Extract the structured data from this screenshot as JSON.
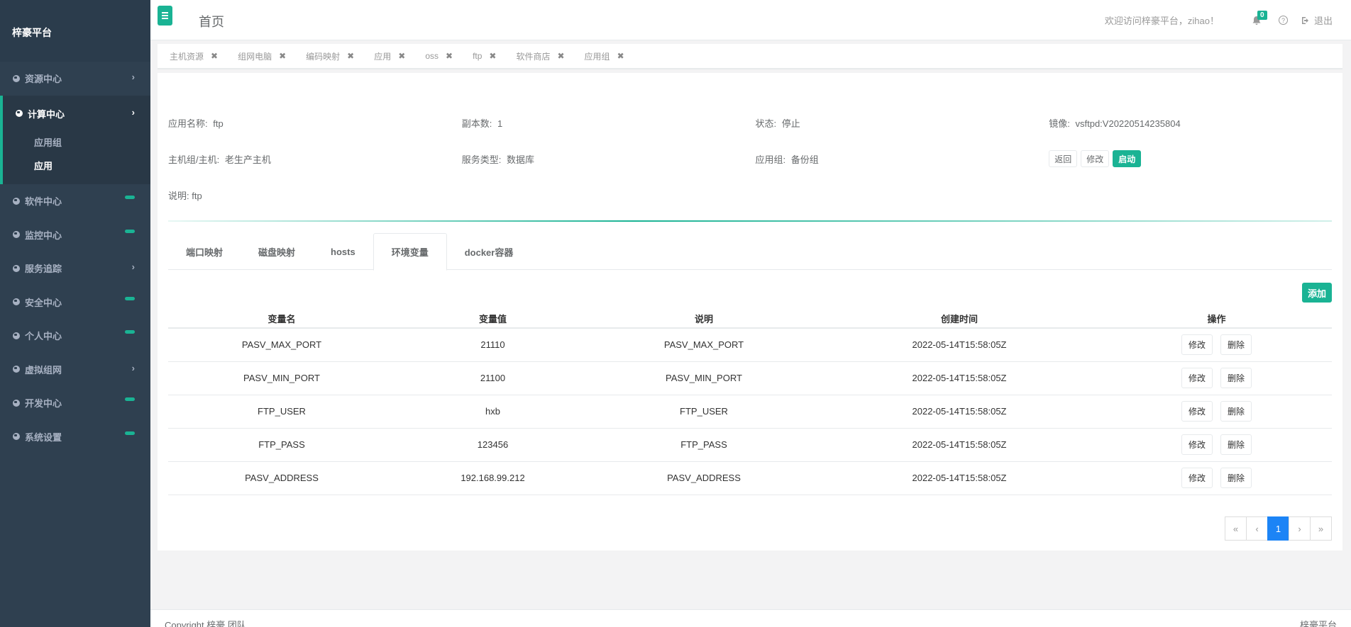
{
  "app": {
    "brand": "梓豪平台",
    "page_title": "首页"
  },
  "sidebar": {
    "items": [
      {
        "label": "资源中心",
        "marker": "chevron"
      },
      {
        "label": "计算中心",
        "marker": "chevron",
        "active": true,
        "children": [
          {
            "label": "应用组"
          },
          {
            "label": "应用",
            "active": true
          }
        ]
      },
      {
        "label": "软件中心",
        "marker": "pill"
      },
      {
        "label": "监控中心",
        "marker": "pill"
      },
      {
        "label": "服务追踪",
        "marker": "chevron"
      },
      {
        "label": "安全中心",
        "marker": "pill"
      },
      {
        "label": "个人中心",
        "marker": "pill"
      },
      {
        "label": "虚拟组网",
        "marker": "chevron"
      },
      {
        "label": "开发中心",
        "marker": "pill"
      },
      {
        "label": "系统设置",
        "marker": "pill"
      }
    ]
  },
  "topbar": {
    "welcome": "欢迎访问梓豪平台，zihao！",
    "notification_count": "0",
    "logout_label": "退出"
  },
  "page_tabs": [
    "主机资源",
    "组网电脑",
    "编码映射",
    "应用",
    "oss",
    "ftp",
    "软件商店",
    "应用组"
  ],
  "detail": {
    "app_name_label": "应用名称:",
    "app_name": "ftp",
    "replicas_label": "副本数:",
    "replicas": "1",
    "status_label": "状态:",
    "status": "停止",
    "image_label": "镜像:",
    "image": "vsftpd:V20220514235804",
    "host_label": "主机组/主机:",
    "host": "老生产主机",
    "service_type_label": "服务类型:",
    "service_type": "数据库",
    "app_group_label": "应用组:",
    "app_group": "备份组",
    "description_label": "说明:",
    "description": "ftp",
    "back_button": "返回",
    "edit_button": "修改",
    "start_button": "启动"
  },
  "sub_tabs": [
    {
      "label": "端口映射"
    },
    {
      "label": "磁盘映射"
    },
    {
      "label": "hosts"
    },
    {
      "label": "环境变量",
      "active": true
    },
    {
      "label": "docker容器"
    }
  ],
  "env_table": {
    "add_button": "添加",
    "columns": [
      "变量名",
      "变量值",
      "说明",
      "创建时间",
      "操作"
    ],
    "rows": [
      {
        "name": "PASV_MAX_PORT",
        "value": "21110",
        "desc": "PASV_MAX_PORT",
        "created": "2022-05-14T15:58:05Z"
      },
      {
        "name": "PASV_MIN_PORT",
        "value": "21100",
        "desc": "PASV_MIN_PORT",
        "created": "2022-05-14T15:58:05Z"
      },
      {
        "name": "FTP_USER",
        "value": "hxb",
        "desc": "FTP_USER",
        "created": "2022-05-14T15:58:05Z"
      },
      {
        "name": "FTP_PASS",
        "value": "123456",
        "desc": "FTP_PASS",
        "created": "2022-05-14T15:58:05Z"
      },
      {
        "name": "PASV_ADDRESS",
        "value": "192.168.99.212",
        "desc": "PASV_ADDRESS",
        "created": "2022-05-14T15:58:05Z"
      }
    ],
    "row_edit": "修改",
    "row_delete": "删除"
  },
  "pagination": {
    "first": "«",
    "prev": "‹",
    "current": "1",
    "next": "›",
    "last": "»"
  },
  "footer": {
    "left": "Copyright 梓豪 团队",
    "right": "梓豪平台"
  },
  "colors": {
    "accent": "#1ab394",
    "sidebar": "#2f4050",
    "pager_active": "#1c84f6"
  }
}
